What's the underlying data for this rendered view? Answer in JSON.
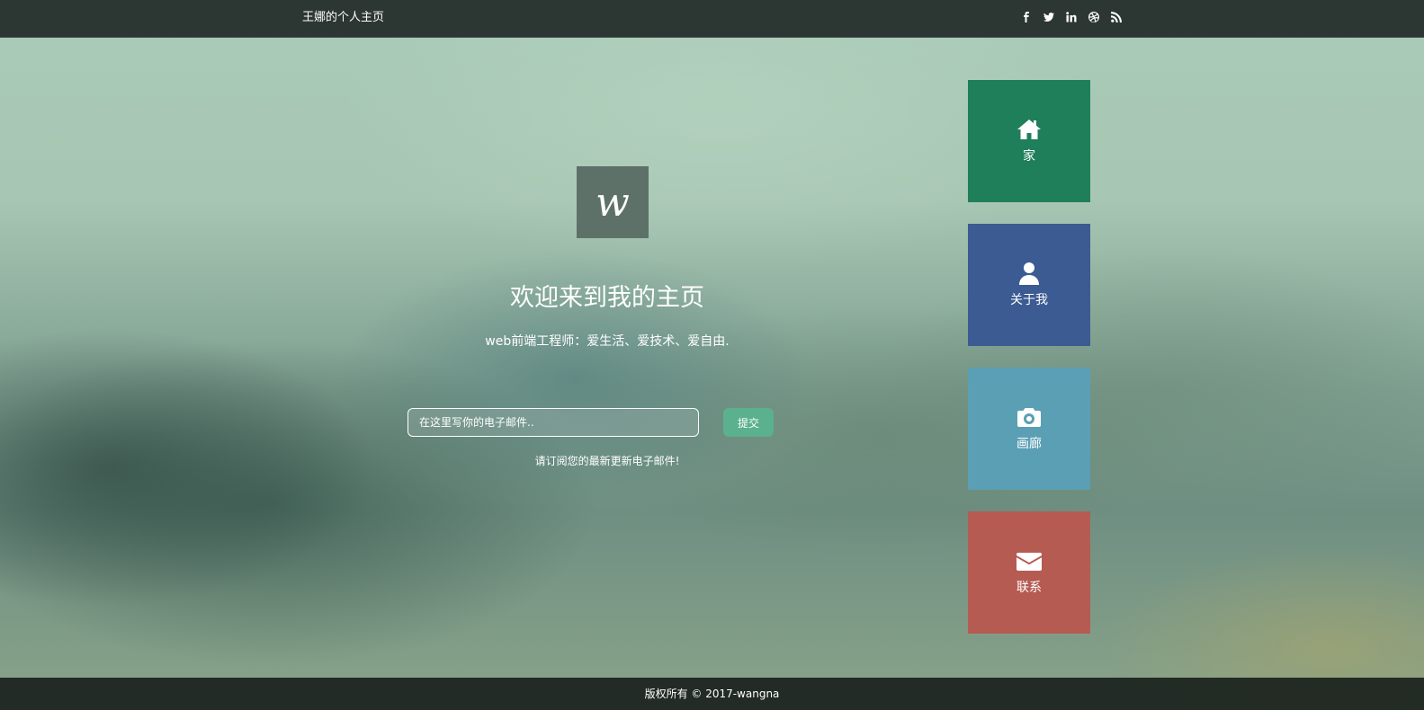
{
  "header": {
    "brand": "王娜的个人主页",
    "social": [
      {
        "name": "facebook-icon",
        "glyph": "f"
      },
      {
        "name": "twitter-icon",
        "glyph": "t"
      },
      {
        "name": "linkedin-icon",
        "glyph": "in"
      },
      {
        "name": "dribbble-icon",
        "glyph": "⊕"
      },
      {
        "name": "rss-icon",
        "glyph": "rss"
      }
    ]
  },
  "hero": {
    "logo_letter": "w",
    "title": "欢迎来到我的主页",
    "tagline": "web前端工程师：爱生活、爱技术、爱自由.",
    "email_placeholder": "在这里写你的电子邮件..",
    "submit_label": "提交",
    "hint": "请订阅您的最新更新电子邮件!"
  },
  "tiles": [
    {
      "label": "家",
      "icon": "home-icon",
      "color": "#1f7f5a"
    },
    {
      "label": "关于我",
      "icon": "user-icon",
      "color": "#3b5b92"
    },
    {
      "label": "画廊",
      "icon": "camera-icon",
      "color": "#5b9fb4"
    },
    {
      "label": "联系",
      "icon": "envelope-icon",
      "color": "#b65b52"
    }
  ],
  "footer": {
    "copyright": "版权所有 © 2017-wangna"
  },
  "colors": {
    "topbar": "#2c3733",
    "submit": "#5bb08d",
    "logo_box": "#5e7169"
  }
}
